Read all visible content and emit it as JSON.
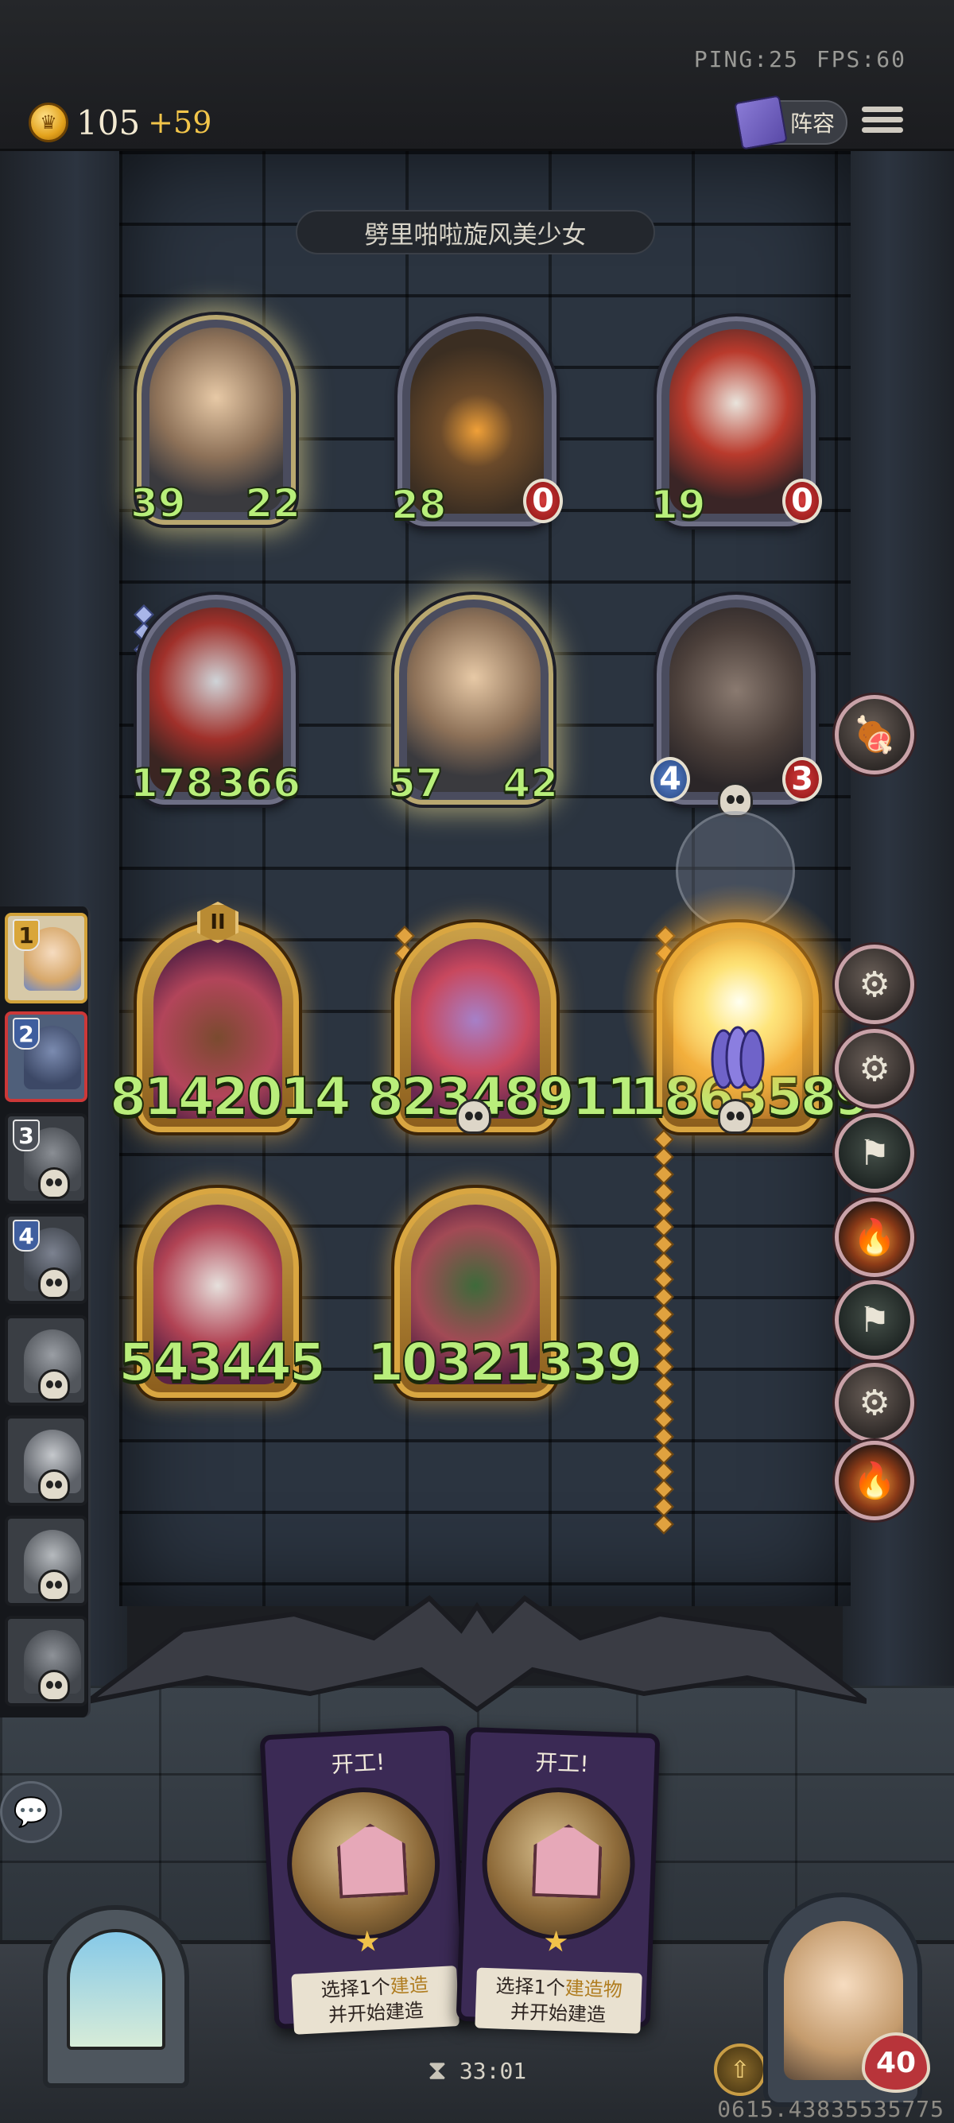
{
  "net": {
    "ping": "PING:25",
    "fps": "FPS:60"
  },
  "currency": {
    "gold": "105",
    "income": "+59"
  },
  "top_bar": {
    "roster_label": "阵容"
  },
  "opponent": {
    "name": "劈里啪啦旋风美少女"
  },
  "board_units": [
    {
      "left": "39",
      "right": "22"
    },
    {
      "left": "28",
      "right": "0"
    },
    {
      "left": "19",
      "right": "0"
    },
    {
      "left": "178",
      "right": "366"
    },
    {
      "left": "57",
      "right": "42"
    },
    {
      "left": "4",
      "right": "3"
    }
  ],
  "shop_units": [
    {
      "rank": "II",
      "value": "8142014"
    },
    {
      "value": "82348911"
    },
    {
      "value": "1863589"
    },
    {
      "value": "543445"
    },
    {
      "value": "10321339"
    }
  ],
  "roster": {
    "slots": [
      "1",
      "2",
      "3",
      "4"
    ]
  },
  "hand_cards": [
    {
      "title": "开工!",
      "line1_prefix": "选择1个",
      "line1_highlight": "建造",
      "line2": "并开始建造"
    },
    {
      "title": "开工!",
      "line1_prefix": "选择1个",
      "line1_highlight": "建造物",
      "line2": "并开始建造"
    }
  ],
  "status": {
    "timer": "33:01",
    "hp": "40",
    "seed": "0615.43835535775"
  },
  "icons": [
    "coin-icon",
    "book-icon",
    "menu-icon",
    "chat-icon",
    "hourglass-icon",
    "upgrade-icon",
    "skull-icon",
    "campfire-icon",
    "flag-icon",
    "workshop-icon"
  ]
}
